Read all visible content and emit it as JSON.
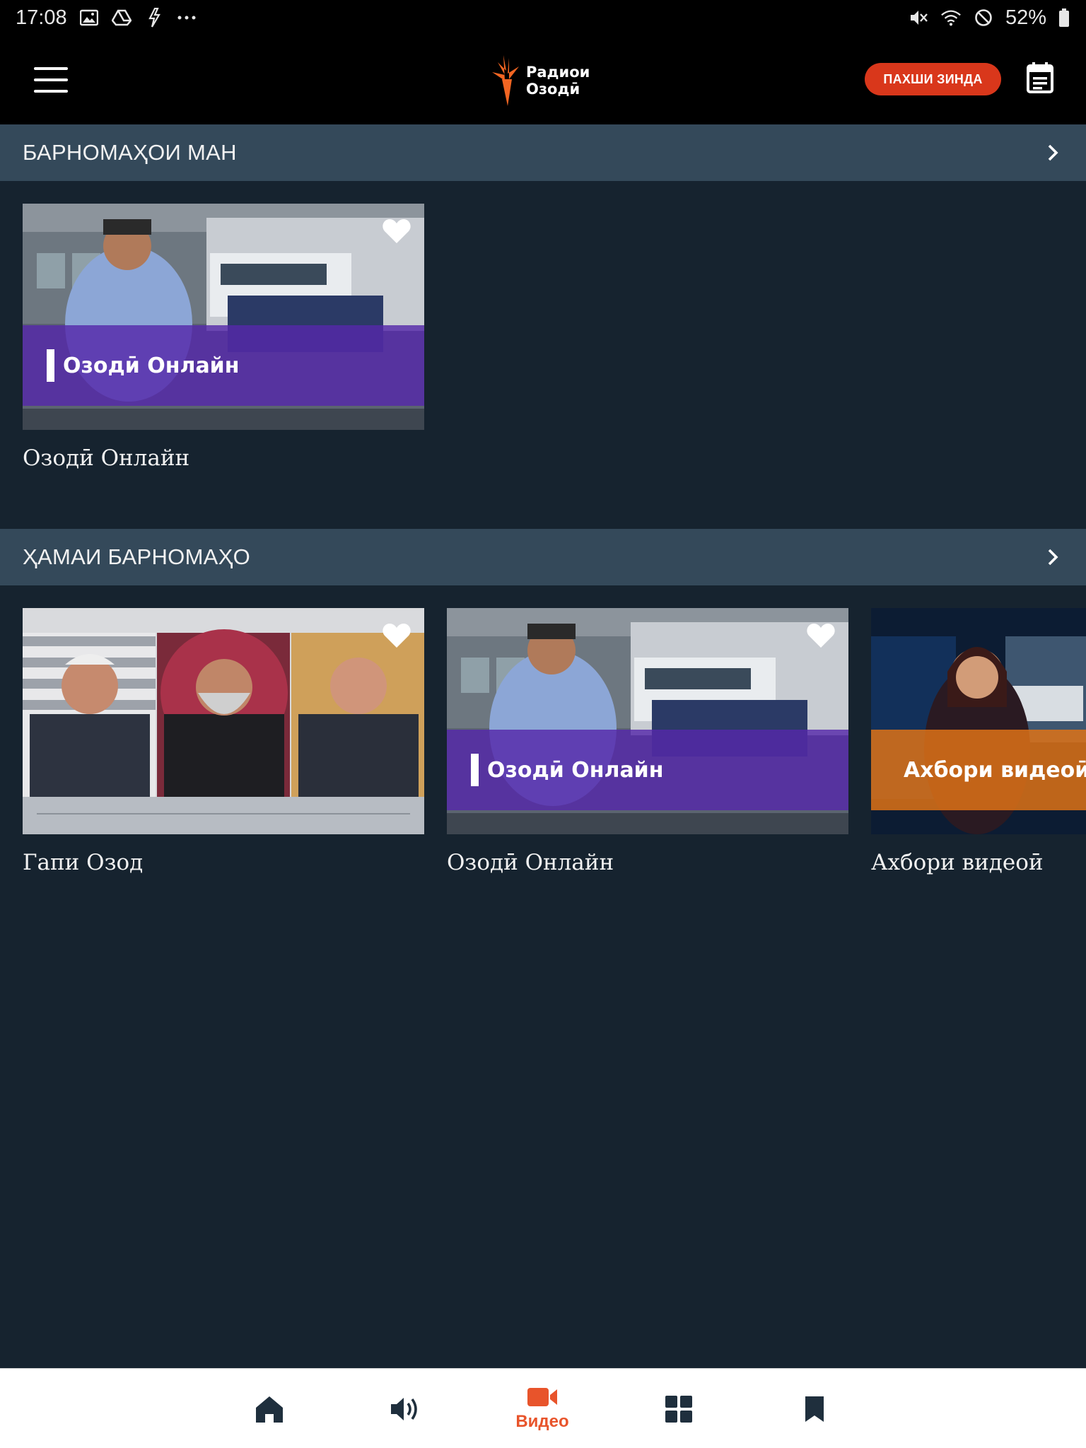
{
  "status_bar": {
    "time": "17:08",
    "left_icons": [
      "image-icon",
      "drive-icon",
      "signal-icon",
      "more-dots-icon"
    ],
    "right_icons": [
      "mute-icon",
      "wifi-icon",
      "block-icon",
      "battery-icon"
    ],
    "battery": "52%"
  },
  "app_bar": {
    "logo_line1": "Радиои",
    "logo_line2": "Озодӣ",
    "live_label": "ПАХШИ ЗИНДА",
    "colors": {
      "accent": "#d9371b",
      "logo_orange": "#f26522"
    }
  },
  "sections": [
    {
      "title": "БАРНОМАҲОИ МАН",
      "cards": [
        {
          "title": "Озодӣ Онлайн",
          "overlay": "Озодӣ Онлайн",
          "favorite": true
        }
      ]
    },
    {
      "title": "ҲАМАИ БАРНОМАҲО",
      "cards": [
        {
          "title": "Гапи Озод",
          "overlay": "",
          "favorite": true
        },
        {
          "title": "Озодӣ Онлайн",
          "overlay": "Озодӣ Онлайн",
          "favorite": true
        },
        {
          "title": "Ахбори видеоӣ",
          "overlay": "Ахбори видеоӣ",
          "favorite": false
        }
      ]
    }
  ],
  "bottom_nav": {
    "items": [
      {
        "icon": "home-icon",
        "label": ""
      },
      {
        "icon": "audio-icon",
        "label": ""
      },
      {
        "icon": "video-icon",
        "label": "Видео",
        "active": true
      },
      {
        "icon": "grid-icon",
        "label": ""
      },
      {
        "icon": "bookmark-icon",
        "label": ""
      }
    ],
    "active_color": "#e8542b",
    "inactive_color": "#1f2f3d"
  }
}
